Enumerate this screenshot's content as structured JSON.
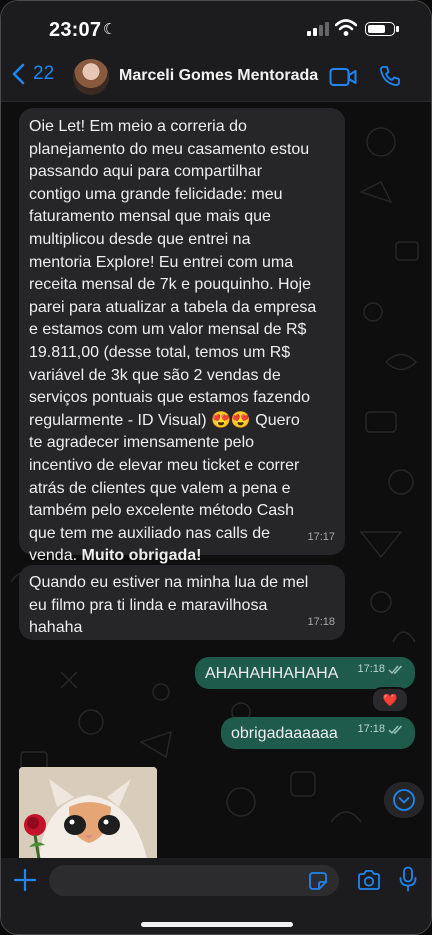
{
  "status_bar": {
    "time": "23:07",
    "moon": "☾"
  },
  "header": {
    "back_count": "22",
    "contact_name": "Marceli Gomes Mentorada",
    "back_icon": "chevron-left-icon",
    "call_icons": [
      "video-call-icon",
      "phone-icon"
    ]
  },
  "messages": [
    {
      "direction": "incoming",
      "text": "Oie Let! Em meio a correria do\nplanejamento do meu casamento estou\npassando aqui para compartilhar\ncontigo uma grande felicidade: meu\nfaturamento mensal que mais que\nmultiplicou desde que entrei na\nmentoria Explore! Eu entrei com uma\nreceita mensal de 7k e pouquinho. Hoje\nparei para atualizar a tabela da empresa\ne estamos com um valor mensal de R$\n19.811,00 (desse total, temos um R$\nvariável de  3k que são 2 vendas de\nserviços pontuais que estamos fazendo\nregularmente - ID Visual) 😍😍 Quero\nte agradecer imensamente pelo\nincentivo de elevar meu ticket e correr\natrás de clientes que valem a pena e\ntambém pelo excelente método Cash\nque tem me auxiliado nas calls de\nvenda. ",
      "bold_text": "Muito obrigada!",
      "time": "17:17"
    },
    {
      "direction": "incoming",
      "text": "Quando eu estiver na minha lua de mel\neu filmo pra ti linda e maravilhosa\nhahaha",
      "time": "17:18"
    },
    {
      "direction": "outgoing",
      "text": "AHAHAHHAHAHA",
      "time": "17:18",
      "reaction": "❤️"
    },
    {
      "direction": "outgoing",
      "text": "obrigadaaaaaa",
      "time": "17:18"
    }
  ],
  "colors": {
    "incoming_bubble": "#262628",
    "outgoing_bubble": "#1f5b4a",
    "accent": "#1f86f2"
  }
}
